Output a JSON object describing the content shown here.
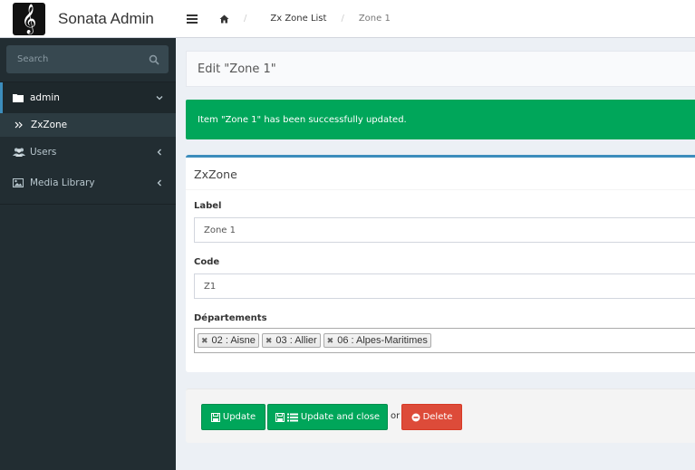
{
  "app": {
    "name": "Sonata Admin"
  },
  "search": {
    "placeholder": "Search"
  },
  "sidebar": {
    "items": [
      {
        "label": "admin"
      },
      {
        "label": "ZxZone"
      },
      {
        "label": "Users"
      },
      {
        "label": "Media Library"
      }
    ]
  },
  "breadcrumb": {
    "list": "Zx Zone List",
    "current": "Zone 1"
  },
  "page": {
    "title": "Edit \"Zone 1\""
  },
  "alert": {
    "message": "Item \"Zone 1\" has been successfully updated."
  },
  "form": {
    "box_title": "ZxZone",
    "label_label": "Label",
    "label_value": "Zone 1",
    "code_label": "Code",
    "code_value": "Z1",
    "departements_label": "Départements",
    "departements": [
      "02 : Aisne",
      "03 : Allier",
      "06 : Alpes-Maritimes"
    ]
  },
  "actions": {
    "update": "Update",
    "update_close": "Update and close",
    "or": "or",
    "delete": "Delete"
  },
  "colors": {
    "sidebar_bg": "#222d32",
    "success": "#00a65a",
    "danger": "#dd4b39",
    "primary": "#3c8dbc"
  }
}
